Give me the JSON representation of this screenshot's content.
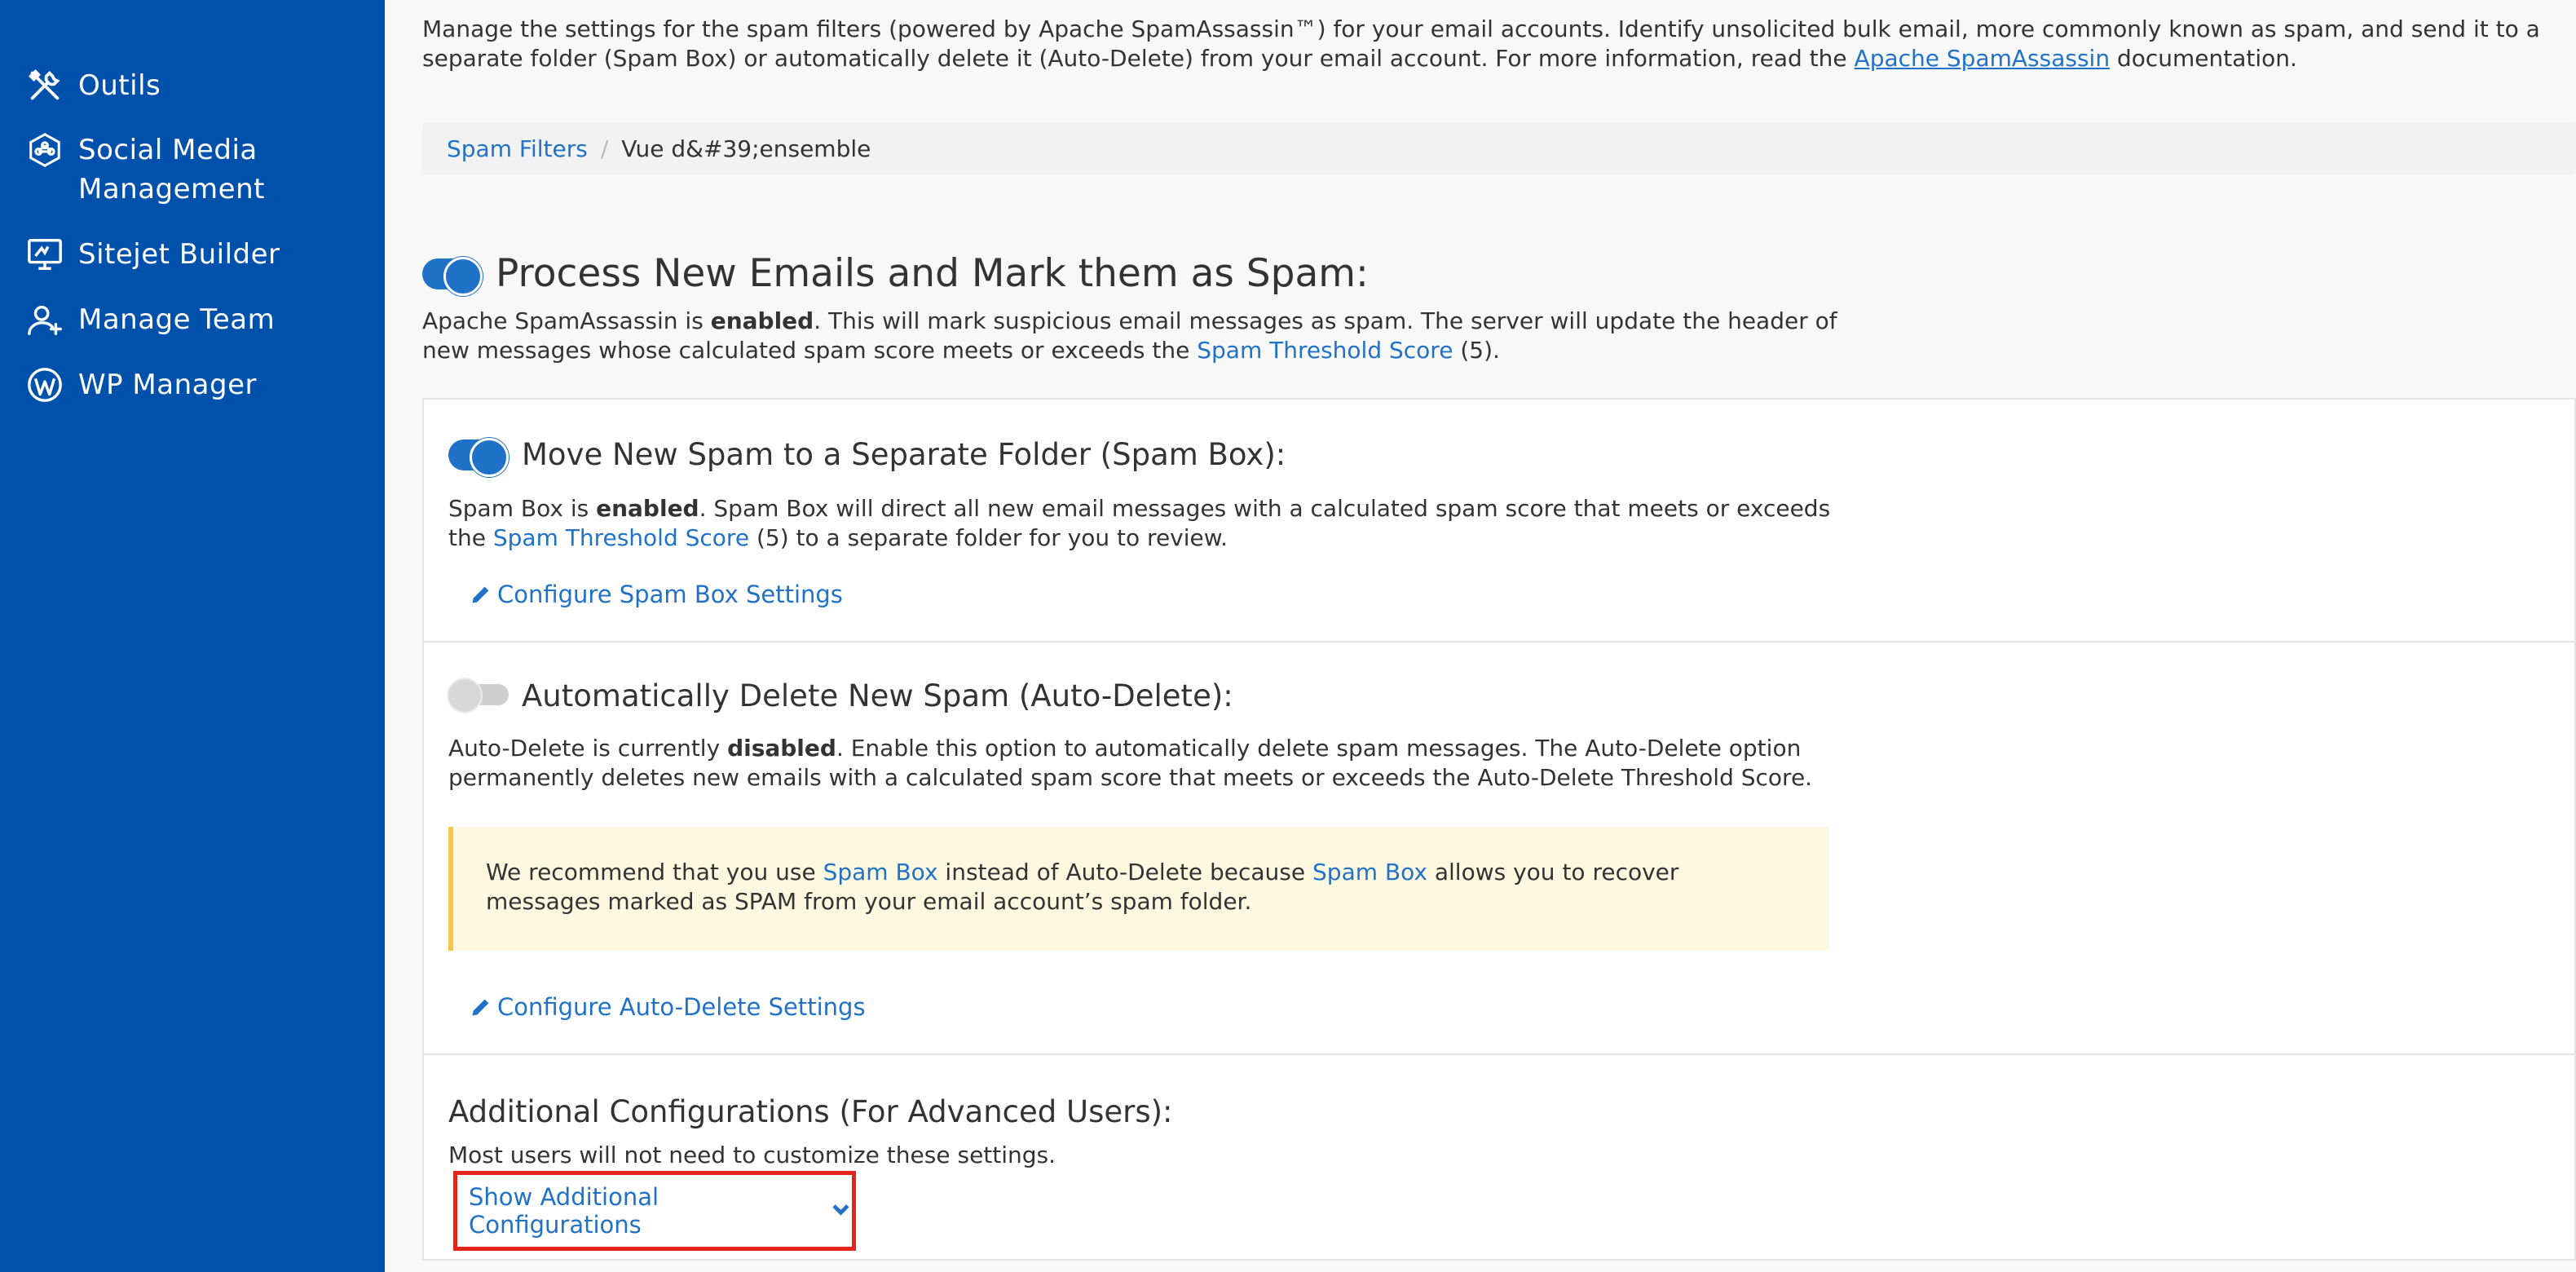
{
  "sidebar": {
    "items": [
      {
        "label": "Outils",
        "icon": "tools-icon"
      },
      {
        "label": "Social Media Management",
        "icon": "social-media-icon"
      },
      {
        "label": "Sitejet Builder",
        "icon": "sitejet-icon"
      },
      {
        "label": "Manage Team",
        "icon": "manage-team-icon"
      },
      {
        "label": "WP Manager",
        "icon": "wordpress-icon"
      }
    ]
  },
  "intro": {
    "text_before": "Manage the settings for the spam filters (powered by Apache SpamAssassin™) for your email accounts. Identify unsolicited bulk email, more commonly known as spam, and send it to a separate folder (Spam Box) or automatically delete it (Auto-Delete) from your email account. For more information, read the ",
    "link": "Apache SpamAssassin",
    "text_after": " documentation."
  },
  "breadcrumb": {
    "link": "Spam Filters",
    "separator": "/",
    "current": "Vue d&#39;ensemble"
  },
  "process": {
    "title": "Process New Emails and Mark them as Spam:",
    "enabled": true,
    "desc_prefix": "Apache SpamAssassin is ",
    "desc_bold": "enabled",
    "desc_mid": ". This will mark suspicious email messages as spam. The server will update the header of new messages whose calculated spam score meets or exceeds the ",
    "desc_link": "Spam Threshold Score",
    "desc_suffix": " (5)."
  },
  "spambox": {
    "title": "Move New Spam to a Separate Folder (Spam Box):",
    "enabled": true,
    "desc_prefix": "Spam Box is ",
    "desc_bold": "enabled",
    "desc_mid": ". Spam Box will direct all new email messages with a calculated spam score that meets or exceeds the ",
    "desc_link": "Spam Threshold Score",
    "desc_suffix": " (5) to a separate folder for you to review.",
    "config_label": "Configure Spam Box Settings"
  },
  "autodelete": {
    "title": "Automatically Delete New Spam (Auto-Delete):",
    "enabled": false,
    "desc_prefix": "Auto-Delete is currently ",
    "desc_bold": "disabled",
    "desc_suffix": ". Enable this option to automatically delete spam messages. The Auto-Delete option permanently deletes new emails with a calculated spam score that meets or exceeds the Auto-Delete Threshold Score.",
    "alert_prefix": "We recommend that you use ",
    "alert_link1": "Spam Box",
    "alert_mid": " instead of Auto-Delete because ",
    "alert_link2": "Spam Box",
    "alert_suffix": " allows you to recover messages marked as SPAM from your email account’s spam folder.",
    "config_label": "Configure Auto-Delete Settings"
  },
  "advanced": {
    "title": "Additional Configurations (For Advanced Users):",
    "text": "Most users will not need to customize these settings.",
    "show_label": "Show Additional Configurations"
  },
  "colors": {
    "sidebar": "#0051ac",
    "link": "#1f72c7",
    "alert_bg": "#fef8e1",
    "alert_border": "#f2c94c",
    "highlight": "#e2261b"
  }
}
